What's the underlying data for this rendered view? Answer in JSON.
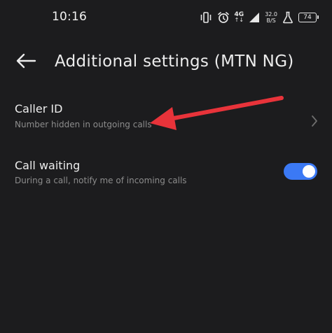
{
  "status_bar": {
    "time": "10:16",
    "network_type": "4G",
    "network_sub": "↑↓",
    "speed_value": "32.0",
    "speed_unit": "B/S",
    "battery_level": "74",
    "icons": [
      "vibrate-icon",
      "alarm-icon",
      "signal-icon",
      "flask-icon",
      "battery-icon"
    ]
  },
  "header": {
    "title": "Additional settings (MTN NG)",
    "back_icon": "back-arrow-icon"
  },
  "settings": {
    "caller_id": {
      "title": "Caller ID",
      "subtitle": "Number hidden in outgoing calls"
    },
    "call_waiting": {
      "title": "Call waiting",
      "subtitle": "During a call, notify me of incoming calls",
      "enabled": true
    }
  },
  "colors": {
    "background": "#1c1c1e",
    "toggle_on": "#3b79f5",
    "annotation_arrow": "#e8333a"
  }
}
